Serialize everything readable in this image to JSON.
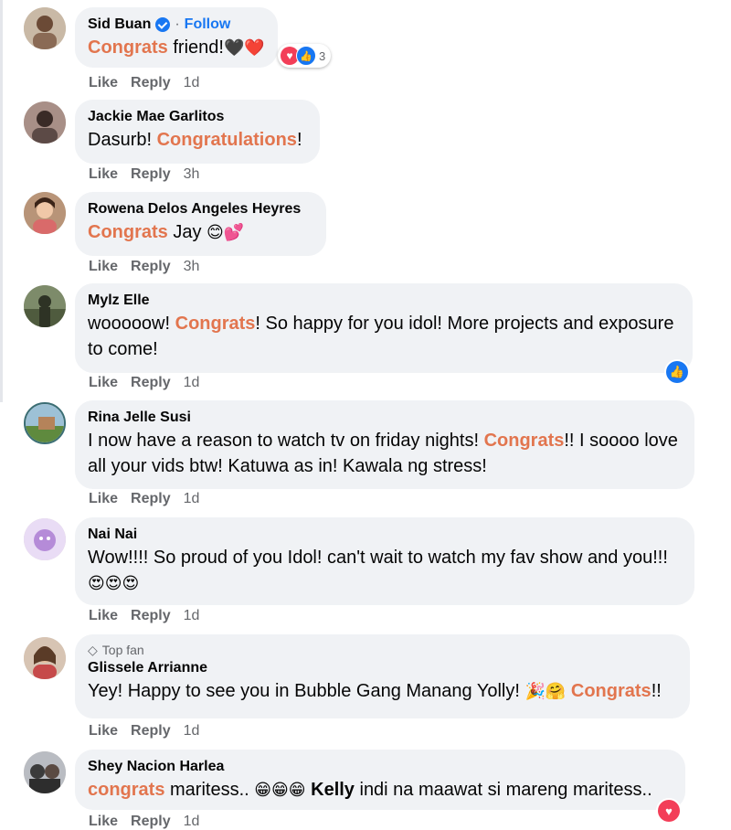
{
  "colors": {
    "accent": "#1877f2",
    "highlight": "#e2754e",
    "bubble": "#f0f2f5",
    "meta": "#65676b",
    "love": "#f33e58"
  },
  "comments": [
    {
      "author": "Sid Buan",
      "follow": "Follow",
      "parts": [
        [
          "Congrats",
          "hl"
        ],
        [
          " friend!",
          ""
        ],
        [
          "🖤❤️",
          "emoji"
        ]
      ],
      "reactions": {
        "icons": [
          "love-icon",
          "like-icon"
        ],
        "count": "3"
      },
      "like": "Like",
      "reply": "Reply",
      "time": "1d"
    },
    {
      "author": "Jackie Mae Garlitos",
      "parts": [
        [
          "Dasurb! ",
          ""
        ],
        [
          "Congratulations",
          "hl"
        ],
        [
          "!",
          ""
        ]
      ],
      "like": "Like",
      "reply": "Reply",
      "time": "3h"
    },
    {
      "author": "Rowena Delos Angeles Heyres",
      "parts": [
        [
          "Congrats",
          "hl"
        ],
        [
          " Jay ",
          ""
        ],
        [
          "😊💕",
          "emoji"
        ]
      ],
      "like": "Like",
      "reply": "Reply",
      "time": "3h"
    },
    {
      "author": "Mylz Elle",
      "parts": [
        [
          "wooooow! ",
          ""
        ],
        [
          "Congrats",
          "hl"
        ],
        [
          "! So happy for you idol! More projects and exposure to come!",
          ""
        ]
      ],
      "reactions": {
        "icons": [
          "like-icon"
        ]
      },
      "like": "Like",
      "reply": "Reply",
      "time": "1d"
    },
    {
      "author": "Rina Jelle Susi",
      "parts": [
        [
          "I now have a reason to watch tv on friday nights! ",
          ""
        ],
        [
          "Congrats",
          "hl"
        ],
        [
          "!! I soooo love all your vids btw! Katuwa as in! Kawala ng stress!",
          ""
        ]
      ],
      "like": "Like",
      "reply": "Reply",
      "time": "1d"
    },
    {
      "author": "Nai Nai",
      "parts": [
        [
          "Wow!!!! So proud of you Idol! can't wait to watch my fav show and you!!! ",
          ""
        ],
        [
          "😍😍😍",
          "emoji"
        ]
      ],
      "like": "Like",
      "reply": "Reply",
      "time": "1d"
    },
    {
      "author": "Glissele Arrianne",
      "badge": "Top fan",
      "parts": [
        [
          "Yey! Happy to see you in Bubble Gang Manang Yolly! ",
          ""
        ],
        [
          "🎉🤗",
          "emoji"
        ],
        [
          " ",
          ""
        ],
        [
          "Congrats",
          "hl"
        ],
        [
          "!!",
          ""
        ]
      ],
      "like": "Like",
      "reply": "Reply",
      "time": "1d"
    },
    {
      "author": "Shey Nacion Harlea",
      "parts": [
        [
          "congrats",
          "hl"
        ],
        [
          " maritess.. ",
          ""
        ],
        [
          "😁😁😁",
          "emoji"
        ],
        [
          " ",
          ""
        ],
        [
          "Kelly",
          "hl-dark"
        ],
        [
          " indi na maawat si mareng maritess..",
          ""
        ]
      ],
      "reactions": {
        "icons": [
          "love-icon"
        ]
      },
      "like": "Like",
      "reply": "Reply",
      "time": "1d"
    }
  ]
}
